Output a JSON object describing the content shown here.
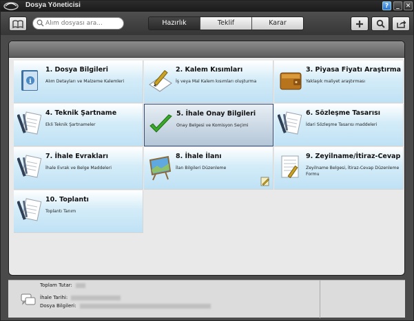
{
  "window": {
    "title": "Dosya Yöneticisi"
  },
  "toolbar": {
    "search_placeholder": "Alım dosyası ara...",
    "tabs": [
      {
        "label": "Hazırlık",
        "active": true
      },
      {
        "label": "Teklif",
        "active": false
      },
      {
        "label": "Karar",
        "active": false
      }
    ],
    "icons": [
      "book-icon",
      "plus-icon",
      "search-icon",
      "share-icon"
    ]
  },
  "panel": {
    "header": ""
  },
  "tiles": [
    {
      "title": "1. Dosya Bilgileri",
      "desc": "Alım Detayları ve Malzeme Kalemleri",
      "icon": "book-info-icon"
    },
    {
      "title": "2. Kalem Kısımları",
      "desc": "İş veya Mal Kalem kısımları oluşturma",
      "icon": "notepad-pencil-icon"
    },
    {
      "title": "3. Piyasa Fiyatı Araştırma",
      "desc": "Yaklaşık maliyet araştırması",
      "icon": "wallet-icon"
    },
    {
      "title": "4. Teknik Şartname",
      "desc": "Ekli Teknik Şartnameler",
      "icon": "document-pen-icon"
    },
    {
      "title": "5. İhale Onay Bilgileri",
      "desc": "Onay Belgesi ve Komisyon Seçimi",
      "icon": "checkmark-icon",
      "selected": true
    },
    {
      "title": "6. Sözleşme Tasarısı",
      "desc": "İdari Sözleşme Tasarısı maddeleri",
      "icon": "document-pen-icon"
    },
    {
      "title": "7. İhale Evrakları",
      "desc": "İhale Evrak ve Belge Maddeleri",
      "icon": "document-pen-icon"
    },
    {
      "title": "8. İhale İlanı",
      "desc": "İlan Bilgileri Düzenleme",
      "icon": "easel-icon",
      "editable": true
    },
    {
      "title": "9. Zeyilname/İtiraz-Cevap",
      "desc": "Zeyilname Belgesi, İtiraz-Cevap Düzenleme Formu",
      "icon": "document-pen-icon"
    },
    {
      "title": "10. Toplantı",
      "desc": "Toplantı Tanım",
      "icon": "document-pen-icon"
    }
  ],
  "info": {
    "total_label": "Toplam Tutar:",
    "date_label": "İhale Tarihi:",
    "file_label": "Dosya Bilgileri:"
  },
  "colors": {
    "tile_gradient_bottom": "#bfe1f5",
    "selected_border": "#2e4a7a",
    "check_green": "#3aa82a"
  }
}
